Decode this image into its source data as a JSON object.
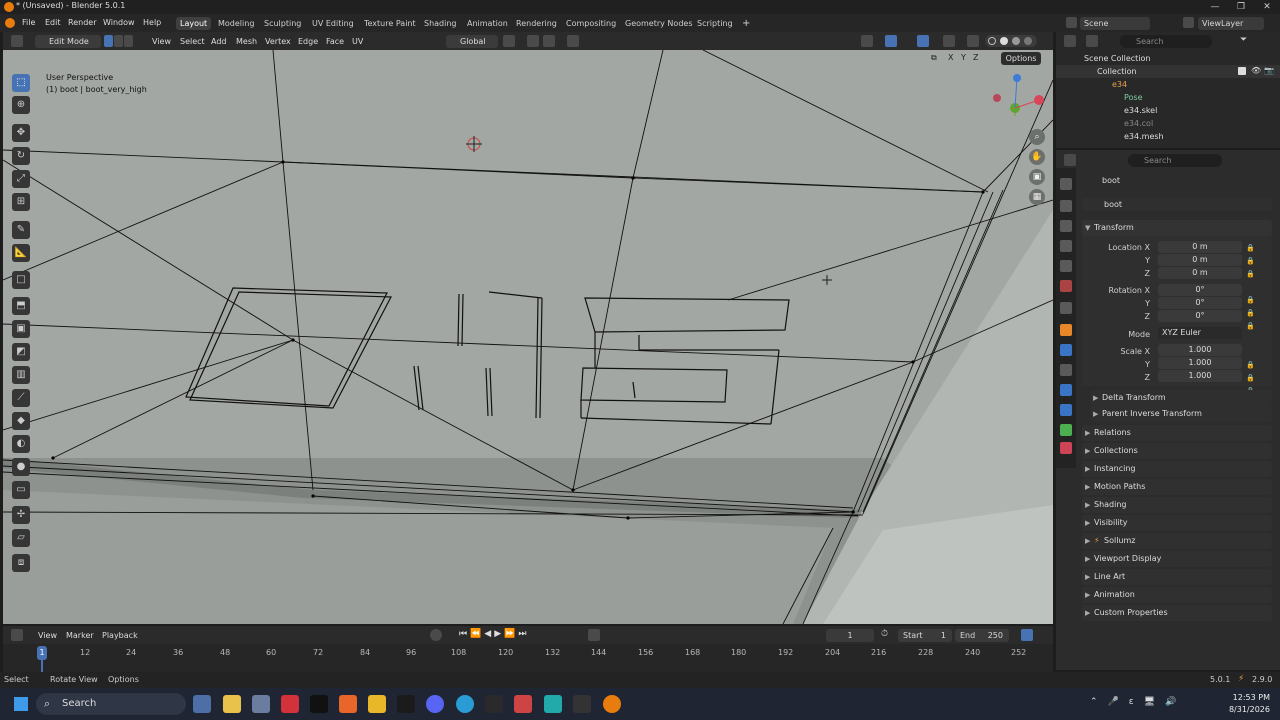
{
  "titlebar": {
    "title": "* (Unsaved) - Blender 5.0.1"
  },
  "menu": {
    "items": [
      "File",
      "Edit",
      "Render",
      "Window",
      "Help"
    ]
  },
  "workspaces": [
    "Layout",
    "Modeling",
    "Sculpting",
    "UV Editing",
    "Texture Paint",
    "Shading",
    "Animation",
    "Rendering",
    "Compositing",
    "Geometry Nodes",
    "Scripting"
  ],
  "scene": {
    "name": "Scene",
    "view_layer": "ViewLayer"
  },
  "viewport_header": {
    "mode": "Edit Mode",
    "menus": [
      "View",
      "Select",
      "Add",
      "Mesh",
      "Vertex",
      "Edge",
      "Face",
      "UV"
    ],
    "orientation": "Global",
    "options_label": "Options",
    "axes": [
      "X",
      "Y",
      "Z"
    ]
  },
  "viewport": {
    "perspective": "User Perspective",
    "object_info": "(1) boot | boot_very_high"
  },
  "outliner": {
    "search_placeholder": "Search",
    "scene_collection": "Scene Collection",
    "collection": "Collection",
    "items": [
      "e34",
      "Pose",
      "e34.skel",
      "e34.col",
      "e34.mesh"
    ]
  },
  "properties": {
    "search_placeholder": "Search",
    "object_name": "boot",
    "object_field": "boot",
    "transform": {
      "header": "Transform",
      "location_label": "Location X",
      "location": [
        "0 m",
        "0 m",
        "0 m"
      ],
      "rotation_label": "Rotation X",
      "rotation": [
        "0°",
        "0°",
        "0°"
      ],
      "mode_label": "Mode",
      "mode": "XYZ Euler",
      "scale_label": "Scale X",
      "scale": [
        "1.000",
        "1.000",
        "1.000"
      ],
      "y": "Y",
      "z": "Z"
    },
    "sub_panels": [
      "Delta Transform",
      "Parent Inverse Transform"
    ],
    "panels": [
      "Relations",
      "Collections",
      "Instancing",
      "Motion Paths",
      "Shading",
      "Visibility",
      "Sollumz",
      "Viewport Display",
      "Line Art",
      "Animation",
      "Custom Properties"
    ]
  },
  "timeline": {
    "menus": [
      "View",
      "Marker",
      "Playback"
    ],
    "current_frame": "1",
    "start_label": "Start",
    "start": "1",
    "end_label": "End",
    "end": "250",
    "ticks": [
      "1",
      "12",
      "24",
      "36",
      "48",
      "60",
      "72",
      "84",
      "96",
      "108",
      "120",
      "132",
      "144",
      "156",
      "168",
      "180",
      "192",
      "204",
      "216",
      "228",
      "240",
      "252"
    ]
  },
  "statusbar": {
    "items": [
      "Select",
      "Rotate View",
      "Options"
    ],
    "version": "5.0.1",
    "addon_version": "2.9.0"
  },
  "taskbar": {
    "search": "Search",
    "time": "12:53 PM",
    "date": "8/31/2026"
  },
  "colors": {
    "accent": "#4772b3",
    "viewport_bg": "#a3a7a3",
    "panel_bg": "#2b2b2b"
  }
}
